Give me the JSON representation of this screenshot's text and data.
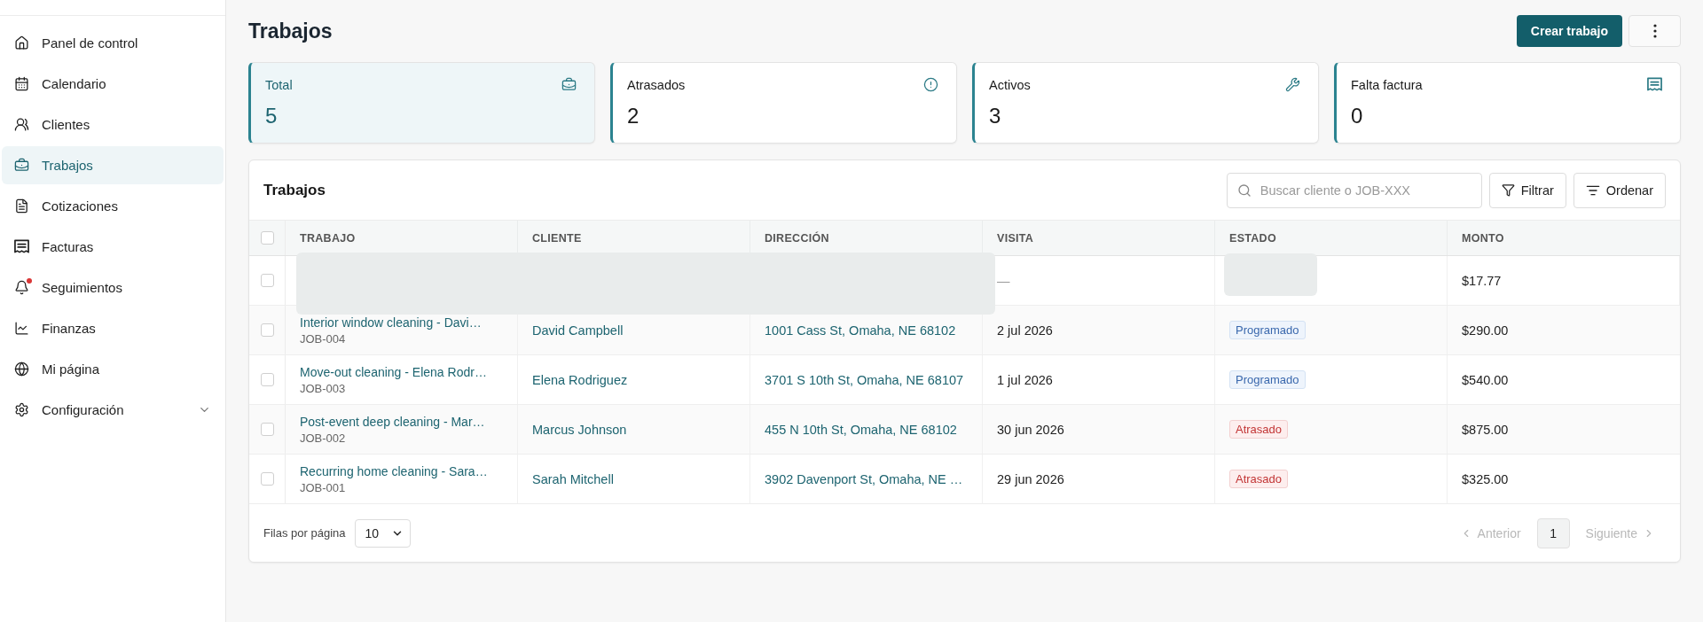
{
  "sidebar": {
    "items": [
      {
        "label": "Panel de control",
        "kind": "home",
        "selected": false,
        "alert": false
      },
      {
        "label": "Calendario",
        "kind": "calendar",
        "selected": false,
        "alert": false
      },
      {
        "label": "Clientes",
        "kind": "clients",
        "selected": false,
        "alert": false
      },
      {
        "label": "Trabajos",
        "kind": "jobs",
        "selected": true,
        "alert": false
      },
      {
        "label": "Cotizaciones",
        "kind": "quotes",
        "selected": false,
        "alert": false
      },
      {
        "label": "Facturas",
        "kind": "invoices",
        "selected": false,
        "alert": false
      },
      {
        "label": "Seguimientos",
        "kind": "followups",
        "selected": false,
        "alert": true
      },
      {
        "label": "Finanzas",
        "kind": "finance",
        "selected": false,
        "alert": false
      },
      {
        "label": "Mi página",
        "kind": "page",
        "selected": false,
        "alert": false
      },
      {
        "label": "Configuración",
        "kind": "settings",
        "selected": false,
        "alert": false,
        "expanded": false
      }
    ]
  },
  "header": {
    "title": "Trabajos",
    "create_button": "Crear trabajo"
  },
  "stats": [
    {
      "label": "Total",
      "value": "5",
      "kind": "total",
      "selected": true
    },
    {
      "label": "Atrasados",
      "value": "2",
      "kind": "overdue",
      "selected": false
    },
    {
      "label": "Activos",
      "value": "3",
      "kind": "active",
      "selected": false
    },
    {
      "label": "Falta factura",
      "value": "0",
      "kind": "uninvoiced",
      "selected": false
    }
  ],
  "table": {
    "title": "Trabajos",
    "search": {
      "placeholder": "Buscar cliente o JOB-XXX"
    },
    "filter_button": "Filtrar",
    "sort_button": "Ordenar",
    "select_all": {
      "checked": false
    },
    "columns": [
      "TRABAJO",
      "CLIENTE",
      "DIRECCIÓN",
      "VISITA",
      "ESTADO",
      "MONTO"
    ],
    "rows": [
      {
        "kind": "loading",
        "checked": false,
        "visit": "—",
        "amount": "$17.77"
      },
      {
        "kind": "job",
        "checked": false,
        "title": "Interior window cleaning - Davi…",
        "job_id": "JOB-004",
        "client": "David Campbell",
        "address": "1001 Cass St, Omaha, NE 68102",
        "visit": "2 jul 2026",
        "status": {
          "label": "Programado",
          "kind": "scheduled"
        },
        "amount": "$290.00"
      },
      {
        "kind": "job",
        "checked": false,
        "title": "Move-out cleaning - Elena Rodr…",
        "job_id": "JOB-003",
        "client": "Elena Rodriguez",
        "address": "3701 S 10th St, Omaha, NE 68107",
        "visit": "1 jul 2026",
        "status": {
          "label": "Programado",
          "kind": "scheduled"
        },
        "amount": "$540.00"
      },
      {
        "kind": "job",
        "checked": false,
        "title": "Post-event deep cleaning - Mar…",
        "job_id": "JOB-002",
        "client": "Marcus Johnson",
        "address": "455 N 10th St, Omaha, NE 68102",
        "visit": "30 jun 2026",
        "status": {
          "label": "Atrasado",
          "kind": "overdue"
        },
        "amount": "$875.00"
      },
      {
        "kind": "job",
        "checked": false,
        "title": "Recurring home cleaning - Sara…",
        "job_id": "JOB-001",
        "client": "Sarah Mitchell",
        "address": "3902 Davenport St, Omaha, NE …",
        "visit": "29 jun 2026",
        "status": {
          "label": "Atrasado",
          "kind": "overdue"
        },
        "amount": "$325.00"
      }
    ]
  },
  "pagination": {
    "rows_per_page_label": "Filas por página",
    "rows_per_page": "10",
    "previous": {
      "label": "Anterior",
      "disabled": true
    },
    "pages": [
      {
        "label": "1",
        "selected": true
      }
    ],
    "next": {
      "label": "Siguiente",
      "disabled": true
    }
  }
}
